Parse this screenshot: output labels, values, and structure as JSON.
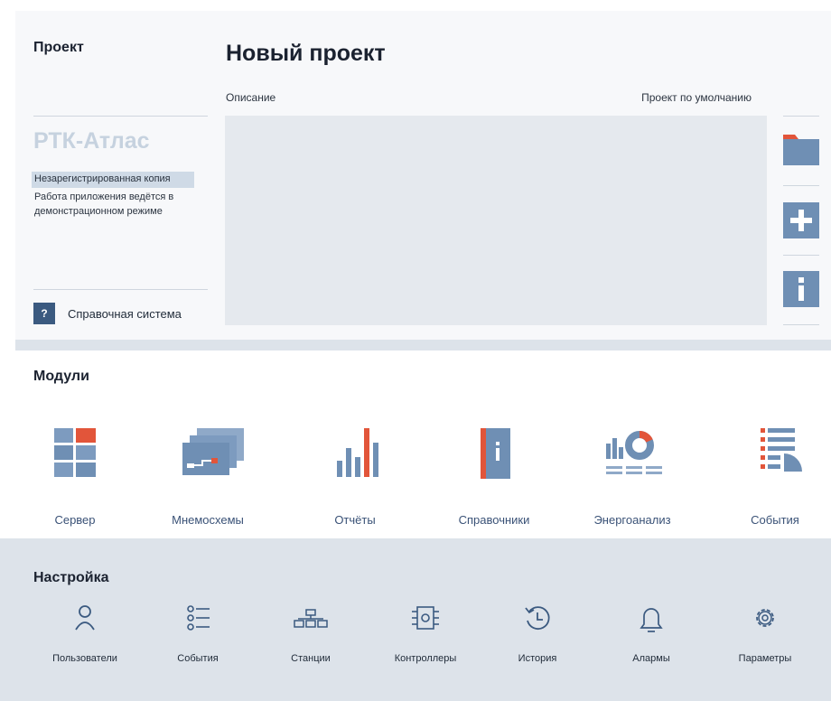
{
  "project": {
    "section_title": "Проект",
    "brand": "РТК-Атлас",
    "unregistered": "Незарегистрированная копия",
    "demo_note": "Работа приложения ведётся  в демонстрационном режиме",
    "help_icon": "?",
    "help_label": "Справочная система",
    "title": "Новый проект",
    "description_label": "Описание",
    "default_label": "Проект по умолчанию",
    "description_value": ""
  },
  "side_actions": [
    {
      "icon": "folder-icon"
    },
    {
      "icon": "plus-icon"
    },
    {
      "icon": "info-icon"
    }
  ],
  "modules": {
    "title": "Модули",
    "items": [
      {
        "label": "Сервер",
        "icon": "server-icon"
      },
      {
        "label": "Мнемосхемы",
        "icon": "mnemonic-icon"
      },
      {
        "label": "Отчёты",
        "icon": "reports-icon"
      },
      {
        "label": "Справочники",
        "icon": "reference-icon"
      },
      {
        "label": "Энергоанализ",
        "icon": "energy-icon"
      },
      {
        "label": "События",
        "icon": "events-icon"
      }
    ]
  },
  "settings": {
    "title": "Настройка",
    "items": [
      {
        "label": "Пользователи",
        "icon": "user-icon"
      },
      {
        "label": "События",
        "icon": "list-icon"
      },
      {
        "label": "Станции",
        "icon": "stations-icon"
      },
      {
        "label": "Контроллеры",
        "icon": "chip-icon"
      },
      {
        "label": "История",
        "icon": "history-icon"
      },
      {
        "label": "Алармы",
        "icon": "bell-icon"
      },
      {
        "label": "Параметры",
        "icon": "gear-icon"
      }
    ]
  },
  "colors": {
    "accent": "#e2553a",
    "icon_blue": "#6f8fb4",
    "panel_gray": "#e5e9ee",
    "settings_bg": "#dde3ea"
  }
}
